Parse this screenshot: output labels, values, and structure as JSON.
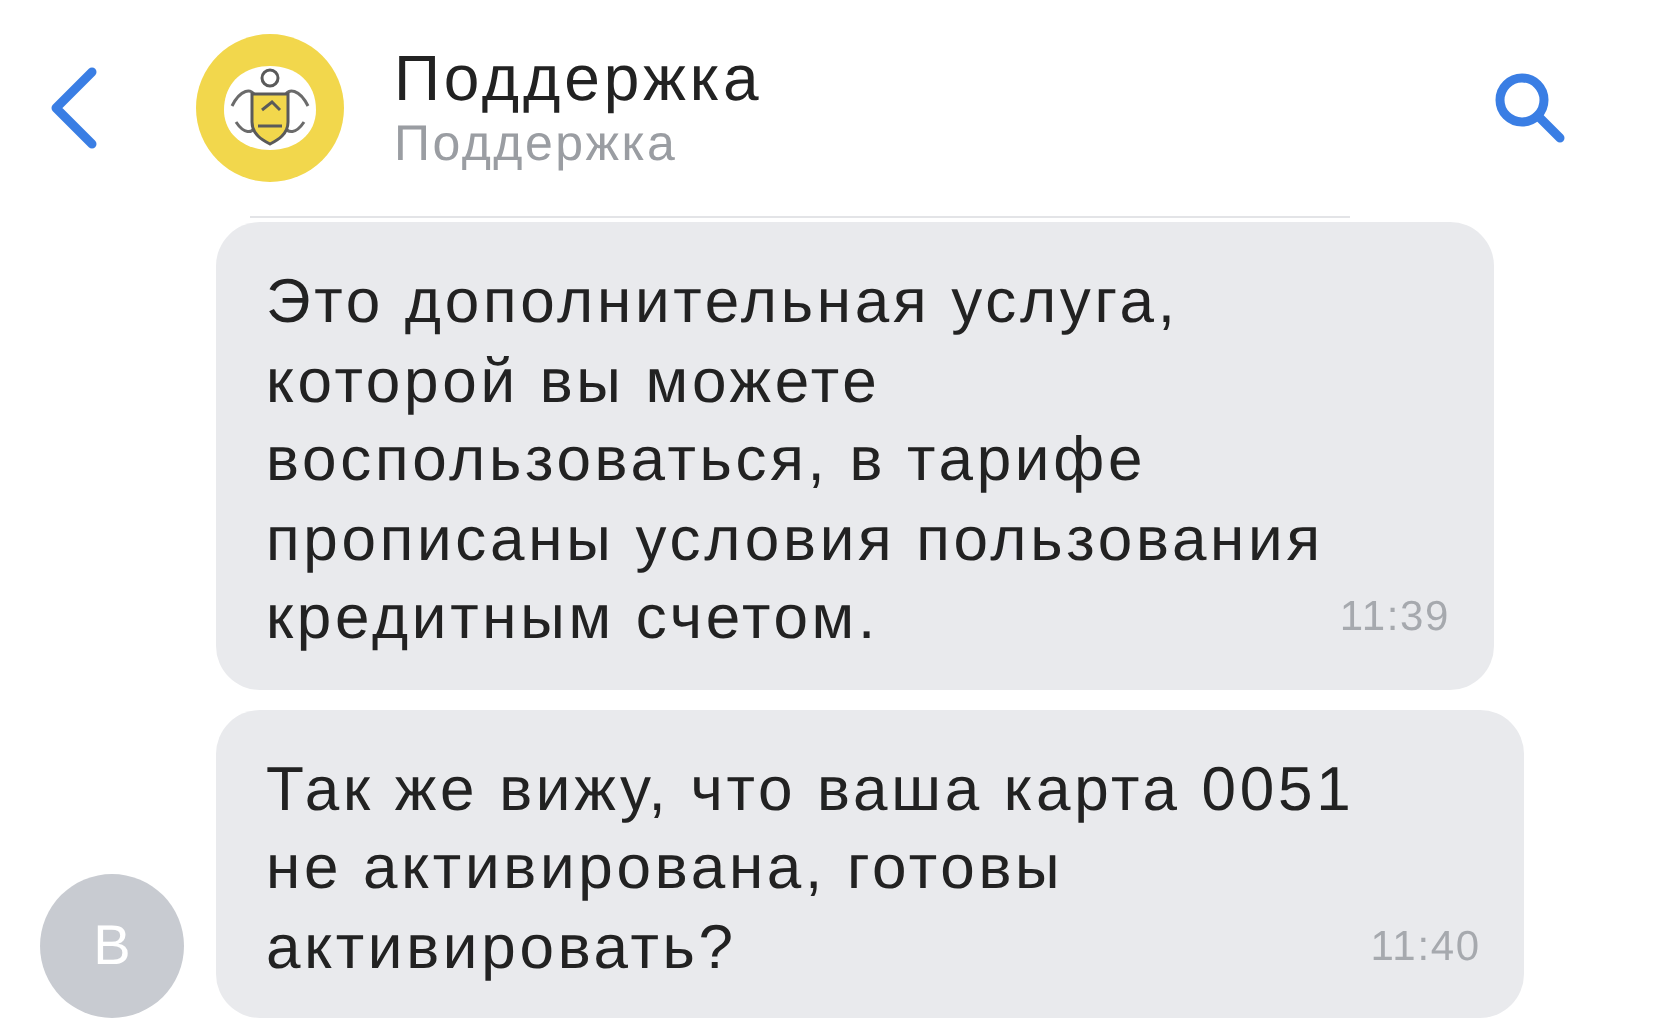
{
  "header": {
    "title": "Поддержка",
    "subtitle": "Поддержка"
  },
  "messages": [
    {
      "lines": [
        "Это дополнительная услуга,",
        "которой вы можете",
        "воспользоваться, в тарифе",
        "прописаны условия пользования",
        "кредитным счетом."
      ],
      "time": "11:39",
      "show_avatar": false
    },
    {
      "lines": [
        "Так же вижу, что ваша карта 0051",
        "не активирована, готовы",
        "активировать?"
      ],
      "time": "11:40",
      "show_avatar": true,
      "avatar_letter": "В"
    }
  ]
}
